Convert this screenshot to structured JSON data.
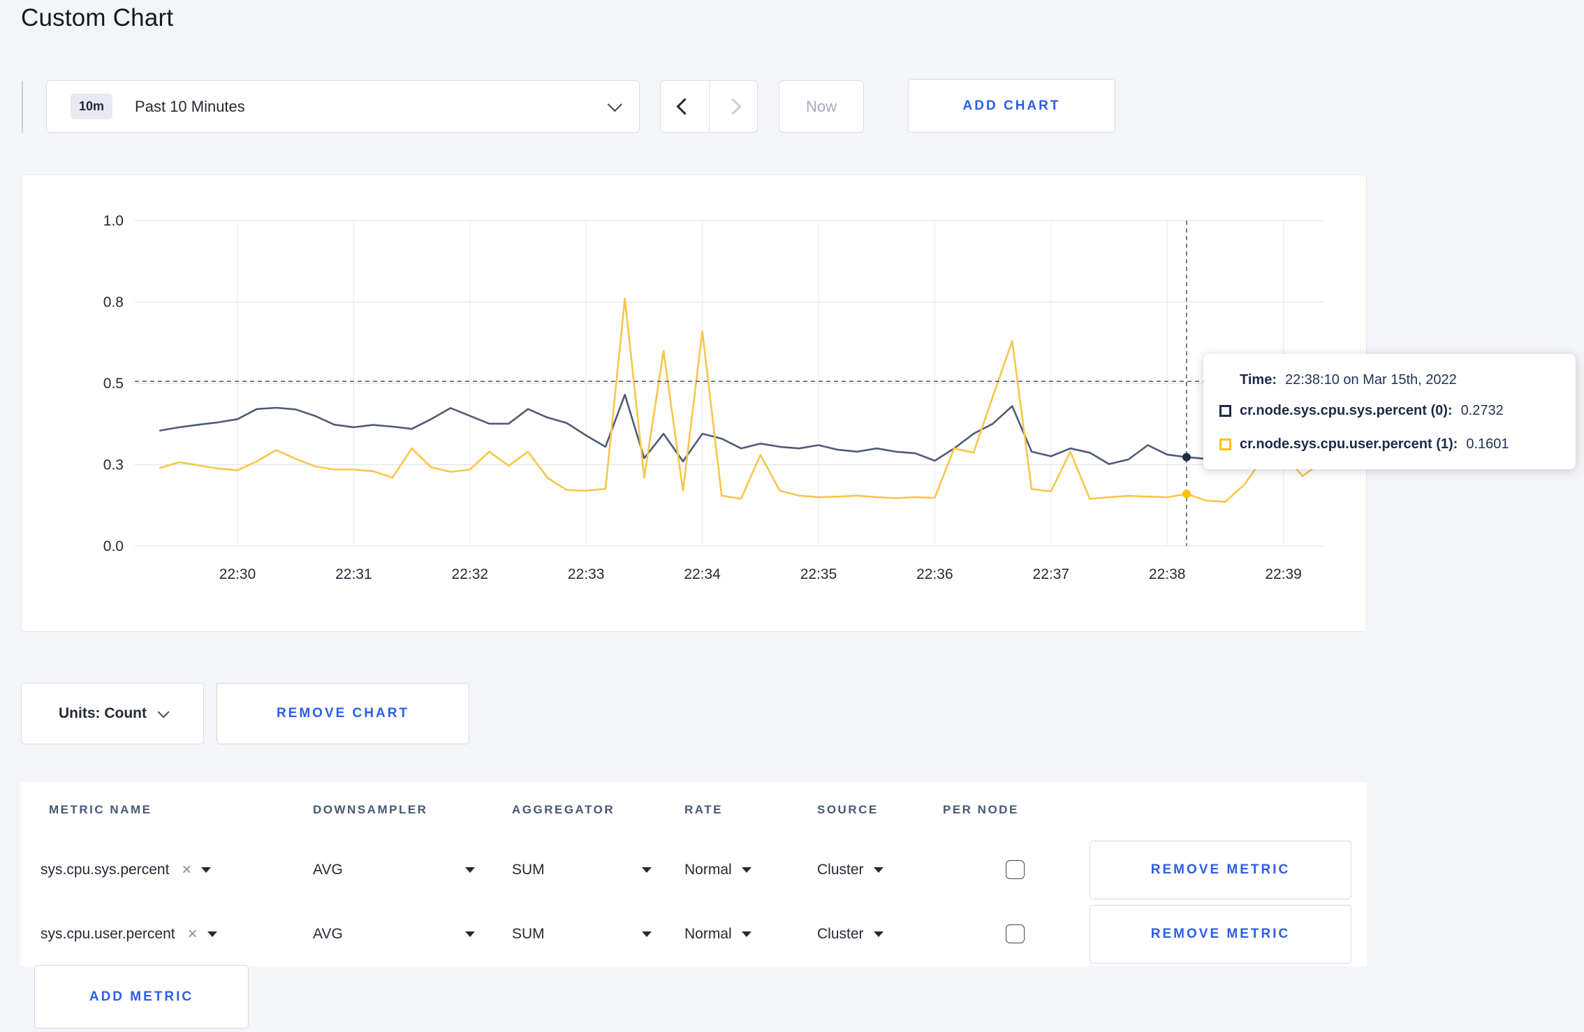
{
  "page": {
    "title": "Custom Chart"
  },
  "toolbar": {
    "range_badge": "10m",
    "range_label": "Past 10 Minutes",
    "now_label": "Now",
    "add_chart_label": "ADD CHART"
  },
  "icons": {
    "clear": "×"
  },
  "units": {
    "label": "Units: Count"
  },
  "remove_chart_label": "REMOVE CHART",
  "chart_data": {
    "type": "line",
    "title": "",
    "xlabel": "",
    "ylabel": "",
    "ylim": [
      0,
      1
    ],
    "grid": true,
    "start_time": "22:29:20",
    "interval_seconds": 10,
    "x_ticks": [
      "22:30",
      "22:31",
      "22:32",
      "22:33",
      "22:34",
      "22:35",
      "22:36",
      "22:37",
      "22:38",
      "22:39"
    ],
    "y_ticks": [
      {
        "label": "0.0",
        "value": 0
      },
      {
        "label": "0.3",
        "value": 0.25
      },
      {
        "label": "0.5",
        "value": 0.5
      },
      {
        "label": "0.8",
        "value": 0.75
      },
      {
        "label": "1.0",
        "value": 1.0
      }
    ],
    "series": [
      {
        "name": "cr.node.sys.cpu.sys.percent (0)",
        "color": "#4d5b76",
        "values": [
          0.355,
          0.365,
          0.373,
          0.38,
          0.39,
          0.421,
          0.425,
          0.42,
          0.4,
          0.373,
          0.365,
          0.372,
          0.367,
          0.36,
          0.39,
          0.424,
          0.4,
          0.376,
          0.376,
          0.421,
          0.395,
          0.378,
          0.34,
          0.305,
          0.465,
          0.27,
          0.345,
          0.26,
          0.345,
          0.33,
          0.3,
          0.315,
          0.305,
          0.3,
          0.31,
          0.296,
          0.29,
          0.3,
          0.29,
          0.285,
          0.262,
          0.3,
          0.345,
          0.376,
          0.43,
          0.29,
          0.276,
          0.3,
          0.287,
          0.252,
          0.266,
          0.31,
          0.281,
          0.2732,
          0.268,
          0.278,
          0.29,
          0.298,
          0.294,
          0.3,
          0.298
        ]
      },
      {
        "name": "cr.node.sys.cpu.user.percent (1)",
        "color": "#f7c64a",
        "values": [
          0.24,
          0.258,
          0.248,
          0.238,
          0.233,
          0.26,
          0.295,
          0.268,
          0.245,
          0.235,
          0.235,
          0.23,
          0.21,
          0.3,
          0.242,
          0.228,
          0.235,
          0.29,
          0.247,
          0.29,
          0.21,
          0.172,
          0.17,
          0.176,
          0.76,
          0.21,
          0.6,
          0.17,
          0.66,
          0.155,
          0.145,
          0.28,
          0.17,
          0.155,
          0.15,
          0.152,
          0.155,
          0.15,
          0.147,
          0.15,
          0.148,
          0.3,
          0.287,
          0.46,
          0.63,
          0.175,
          0.168,
          0.29,
          0.145,
          0.15,
          0.154,
          0.152,
          0.15,
          0.1601,
          0.14,
          0.136,
          0.19,
          0.275,
          0.28,
          0.215,
          0.26
        ]
      }
    ],
    "crosshair": {
      "time": "22:38:10",
      "y_guideline_value": 0.506,
      "time_title": "Time:",
      "time_value": "22:38:10 on Mar 15th, 2022",
      "readouts": [
        {
          "label": "cr.node.sys.cpu.sys.percent (0):",
          "value": "0.2732",
          "color": "#1c2b4a"
        },
        {
          "label": "cr.node.sys.cpu.user.percent (1):",
          "value": "0.1601",
          "color": "#fdc206"
        }
      ]
    },
    "legend_position": "tooltip"
  },
  "table": {
    "headers": [
      "METRIC NAME",
      "DOWNSAMPLER",
      "AGGREGATOR",
      "RATE",
      "SOURCE",
      "PER NODE"
    ],
    "rows": [
      {
        "metric": "sys.cpu.sys.percent",
        "downsampler": "AVG",
        "aggregator": "SUM",
        "rate": "Normal",
        "source": "Cluster",
        "per_node_checked": false,
        "remove_label": "REMOVE METRIC"
      },
      {
        "metric": "sys.cpu.user.percent",
        "downsampler": "AVG",
        "aggregator": "SUM",
        "rate": "Normal",
        "source": "Cluster",
        "per_node_checked": false,
        "remove_label": "REMOVE METRIC"
      }
    ],
    "add_metric_label": "ADD METRIC"
  }
}
